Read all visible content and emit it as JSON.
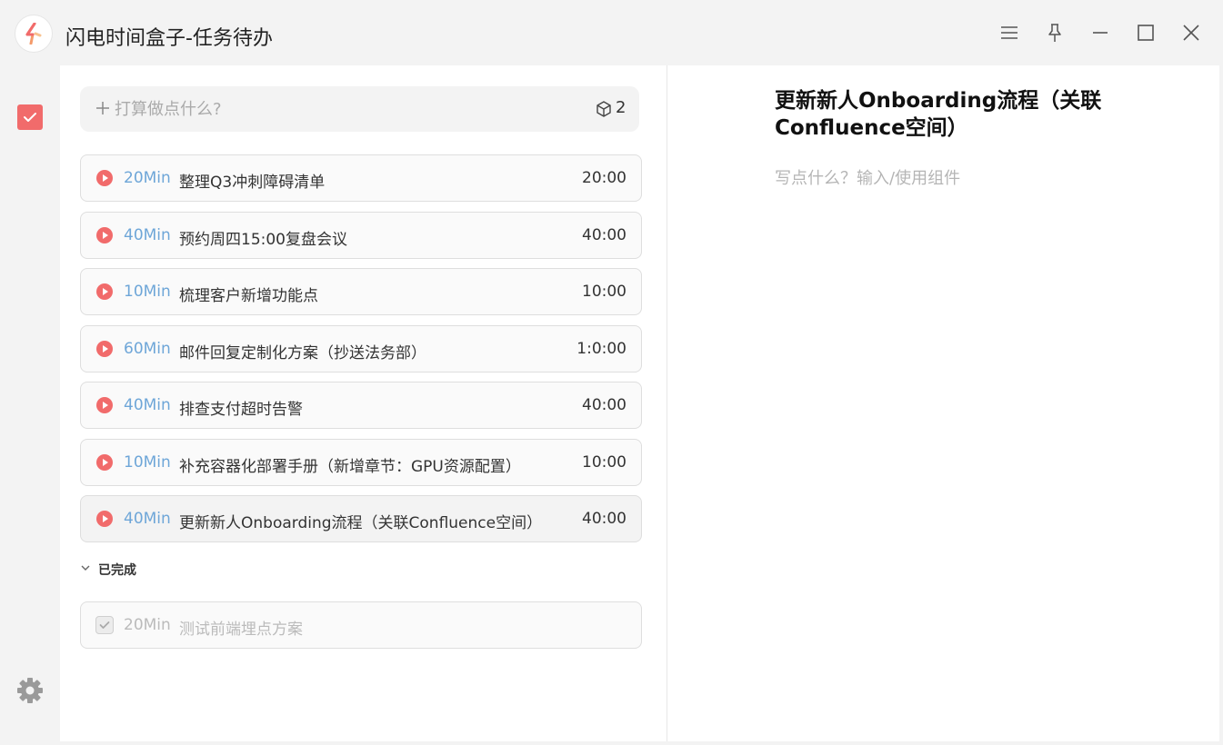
{
  "window": {
    "title": "闪电时间盒子-任务待办",
    "controls": [
      "menu-icon",
      "pin-icon",
      "minimize-icon",
      "maximize-icon",
      "close-icon"
    ]
  },
  "colors": {
    "accent": "#f16b6b",
    "minutes": "#6ea6d8",
    "panel": "#ffffff",
    "chrome": "#f3f3f3"
  },
  "sidebar": {
    "items": [
      {
        "icon": "todo-check-icon",
        "active": true
      },
      {
        "icon": "gear-icon"
      }
    ]
  },
  "add_task": {
    "placeholder": "打算做点什么?",
    "count": "2"
  },
  "tasks": [
    {
      "minutes": "20Min",
      "name": "整理Q3冲刺障碍清单",
      "time": "20:00"
    },
    {
      "minutes": "40Min",
      "name": "预约周四15:00复盘会议",
      "time": "40:00"
    },
    {
      "minutes": "10Min",
      "name": "梳理客户新增功能点",
      "time": "10:00"
    },
    {
      "minutes": "60Min",
      "name": "邮件回复定制化方案（抄送法务部）",
      "time": "1:0:00"
    },
    {
      "minutes": "40Min",
      "name": "排查支付超时告警",
      "time": "40:00"
    },
    {
      "minutes": "10Min",
      "name": "补充容器化部署手册（新增章节：GPU资源配置）",
      "time": "10:00"
    },
    {
      "minutes": "40Min",
      "name": "更新新人Onboarding流程（关联Confluence空间）",
      "time": "40:00",
      "selected": true
    }
  ],
  "completed": {
    "label": "已完成",
    "items": [
      {
        "minutes": "20Min",
        "name": "测试前端埋点方案"
      }
    ]
  },
  "detail": {
    "title": "更新新人Onboarding流程（关联Confluence空间）",
    "placeholder": "写点什么？输入/使用组件"
  }
}
